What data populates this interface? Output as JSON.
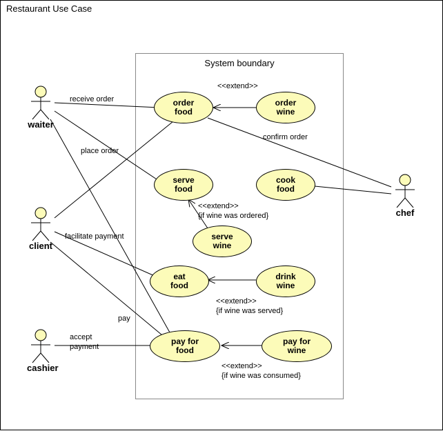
{
  "diagram": {
    "title": "Restaurant Use Case",
    "system_boundary_title": "System boundary"
  },
  "actors": {
    "waiter": "waiter",
    "client": "client",
    "cashier": "cashier",
    "chef": "chef"
  },
  "usecases": {
    "order_food": "order\nfood",
    "order_wine": "order\nwine",
    "serve_food": "serve\nfood",
    "cook_food": "cook\nfood",
    "serve_wine": "serve\nwine",
    "eat_food": "eat\nfood",
    "drink_wine": "drink\nwine",
    "pay_for_food": "pay for\nfood",
    "pay_for_wine": "pay for\nwine"
  },
  "labels": {
    "receive_order": "receive order",
    "place_order": "place order",
    "confirm_order": "confirm order",
    "facilitate_payment": "facilitate payment",
    "pay": "pay",
    "accept_payment_l1": "accept",
    "accept_payment_l2": "payment",
    "extend1": "<<extend>>",
    "extend2": "<<extend>>",
    "extend2_cond": "{if wine was ordered}",
    "extend3": "<<extend>>",
    "extend3_cond": "{if wine was served}",
    "extend4": "<<extend>>",
    "extend4_cond": "{if wine was consumed}"
  },
  "chart_data": {
    "type": "uml-use-case-diagram",
    "title": "Restaurant Use Case",
    "actors": [
      "waiter",
      "client",
      "cashier",
      "chef"
    ],
    "system_boundary": "System boundary",
    "usecases": [
      "order food",
      "order wine",
      "serve food",
      "cook food",
      "serve wine",
      "eat food",
      "drink wine",
      "pay for food",
      "pay for wine"
    ],
    "associations": [
      {
        "actor": "waiter",
        "usecase": "order food",
        "label": "receive order"
      },
      {
        "actor": "waiter",
        "usecase": "serve food"
      },
      {
        "actor": "waiter",
        "usecase": "pay for food",
        "label": "facilitate payment"
      },
      {
        "actor": "client",
        "usecase": "order food",
        "label": "place order"
      },
      {
        "actor": "client",
        "usecase": "eat food"
      },
      {
        "actor": "client",
        "usecase": "pay for food",
        "label": "pay"
      },
      {
        "actor": "cashier",
        "usecase": "pay for food",
        "label": "accept payment"
      },
      {
        "actor": "chef",
        "usecase": "order food",
        "label": "confirm order"
      },
      {
        "actor": "chef",
        "usecase": "cook food"
      }
    ],
    "extends": [
      {
        "from": "order wine",
        "to": "order food",
        "stereotype": "<<extend>>"
      },
      {
        "from": "serve wine",
        "to": "serve food",
        "stereotype": "<<extend>>",
        "condition": "{if wine was ordered}"
      },
      {
        "from": "drink wine",
        "to": "eat food",
        "stereotype": "<<extend>>",
        "condition": "{if wine was served}"
      },
      {
        "from": "pay for wine",
        "to": "pay for food",
        "stereotype": "<<extend>>",
        "condition": "{if wine was consumed}"
      }
    ]
  }
}
